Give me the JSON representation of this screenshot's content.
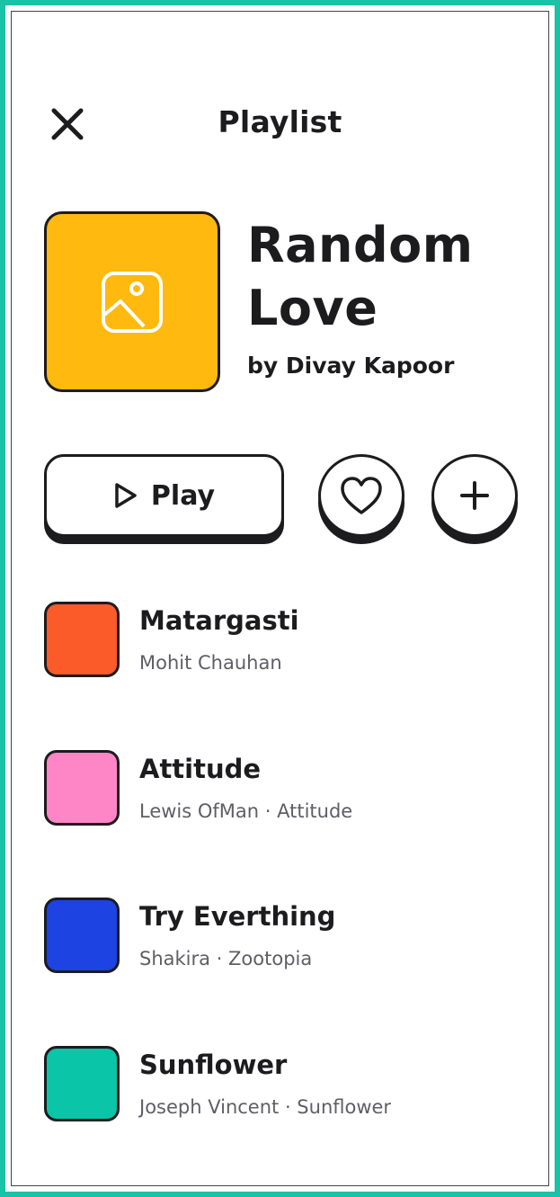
{
  "header": {
    "title": "Playlist",
    "close_icon": "close-icon"
  },
  "playlist": {
    "title": "Random Love",
    "author": "by Divay Kapoor",
    "cover_color": "#ffb90f",
    "cover_icon": "image-placeholder-icon"
  },
  "actions": {
    "play_label": "Play",
    "play_icon": "play-icon",
    "like_icon": "heart-icon",
    "add_icon": "plus-icon"
  },
  "tracks": [
    {
      "title": "Matargasti",
      "subtitle": "Mohit Chauhan",
      "color": "#fb5a29"
    },
    {
      "title": "Attitude",
      "subtitle": "Lewis OfMan · Attitude",
      "color": "#ff86c6"
    },
    {
      "title": "Try Everthing",
      "subtitle": "Shakira · Zootopia",
      "color": "#1d43e3"
    },
    {
      "title": "Sunflower",
      "subtitle": "Joseph Vincent · Sunflower",
      "color": "#0ac5a8"
    }
  ],
  "theme": {
    "frame_color": "#18c3a8",
    "ink_color": "#1c1c1e"
  }
}
